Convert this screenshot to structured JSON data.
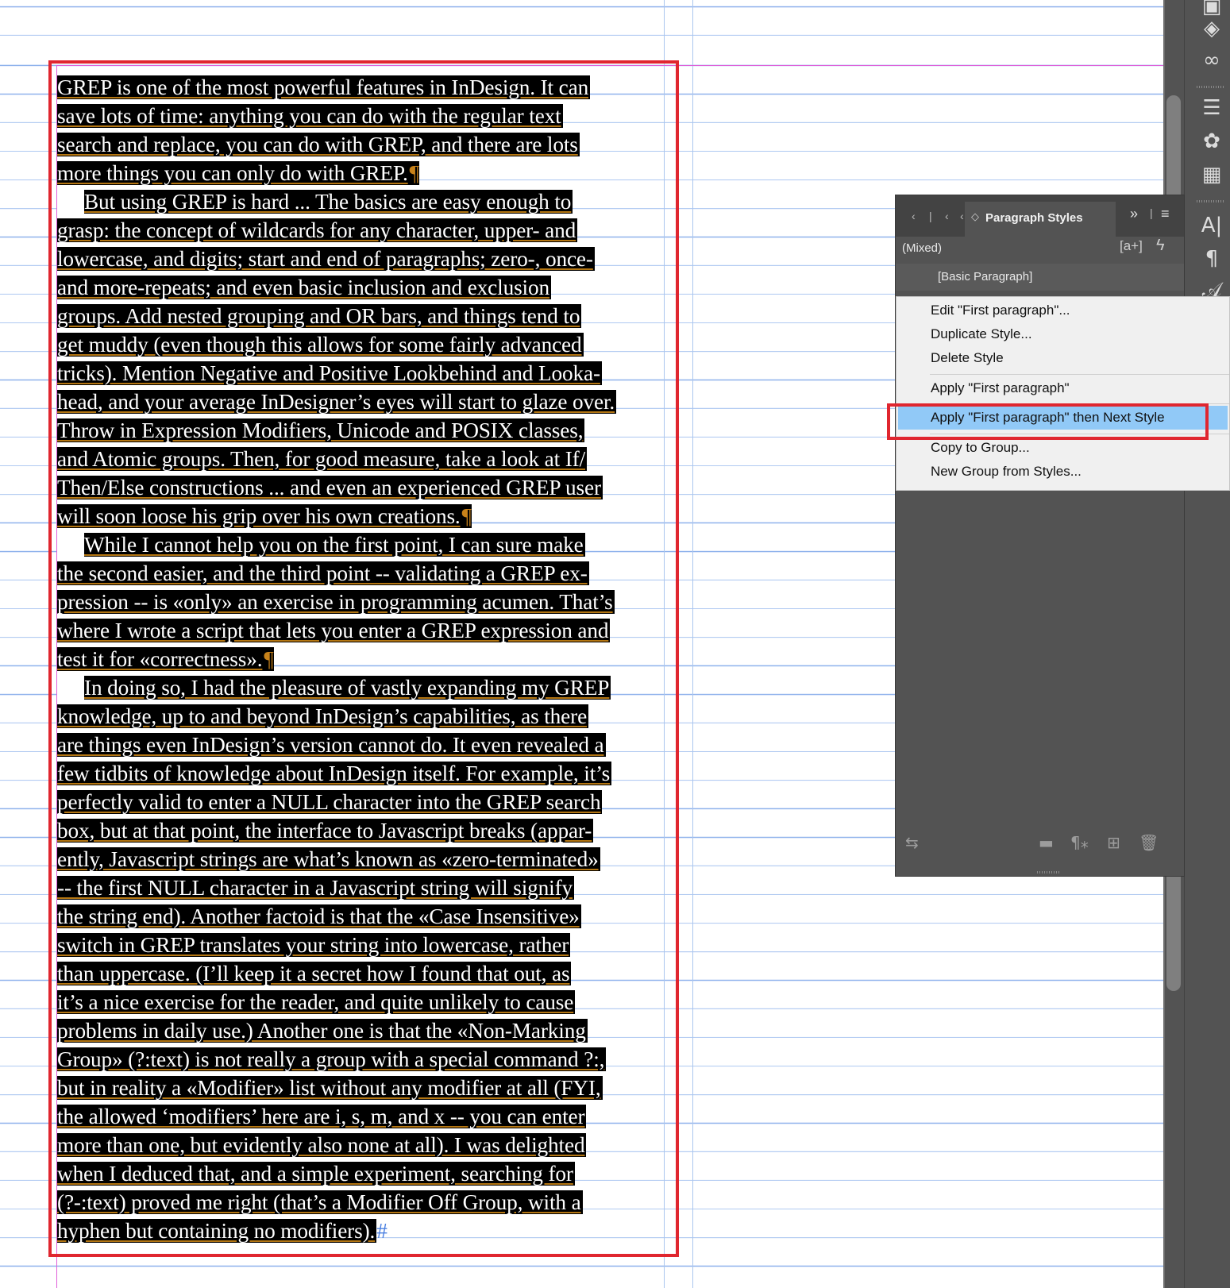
{
  "document": {
    "paragraphs": [
      {
        "lines": [
          "GREP is one of the most powerful features in InDesign. It can",
          "save lots of time: anything you can do with the regular text",
          "search and replace, you can do with GREP, and there are lots",
          "more things you can only do with GREP."
        ]
      },
      {
        "lines": [
          "But using GREP is hard ... The basics are easy enough to",
          "grasp: the concept of wildcards for any character, upper- and",
          "lowercase, and digits; start and end of paragraphs; zero-, once-",
          "and more-repeats; and even basic inclusion and exclusion",
          "groups. Add nested grouping and OR bars, and things tend to",
          "get muddy (even though this allows for some fairly advanced",
          "tricks). Mention Negative and Positive Lookbehind and Looka-",
          "head, and your average InDesigner’s eyes will start to glaze over.",
          "Throw in Expression Modifiers, Unicode and POSIX classes,",
          "and Atomic groups. Then, for good measure, take a look at If/",
          "Then/Else constructions ... and even an experienced GREP user",
          "will soon loose his grip over his own creations."
        ]
      },
      {
        "lines": [
          "While I cannot help you on the first point, I can sure make",
          "the second easier, and the third point -- validating a GREP ex-",
          "pression -- is «only» an exercise in programming acumen. That’s",
          "where I wrote a script that lets you enter a GREP expression and",
          "test it for «correctness»."
        ]
      },
      {
        "lines": [
          "In doing so, I had the pleasure of vastly expanding my GREP",
          "knowledge, up to and beyond InDesign’s capabilities, as there",
          "are things even InDesign’s version cannot do. It even revealed a",
          "few tidbits of knowledge about InDesign itself. For example, it’s",
          "perfectly valid to enter a NULL character into the GREP search",
          "box, but at that point, the interface to Javascript breaks (appar-",
          "ently, Javascript strings are what’s known as «zero-terminated»",
          "-- the first NULL character in a Javascript string will signify",
          "the string end). Another factoid is that the «Case Insensitive»",
          "switch in GREP translates your string into lowercase, rather",
          "than uppercase. (I’ll keep it a secret how I found that out, as",
          "it’s a nice exercise for the reader, and quite unlikely to cause",
          "problems in daily use.) Another one is that the «Non-Marking",
          "Group» (?:text) is not really a group with a special command ?:,",
          "but in reality a «Modifier» list without any modifier at all (FYI,",
          "the allowed ‘modifiers’ here are i, s, m, and x -- you can enter",
          "more than one, but evidently also none at all). I was delighted",
          "when I deduced that, and a simple experiment, searching for",
          "(?-:text) proved me right (that’s a Modifier Off Group, with a",
          "hyphen but containing no modifiers)."
        ]
      }
    ],
    "pilcrow": "¶",
    "end_of_story": "#"
  },
  "panel": {
    "title": "Paragraph Styles",
    "current_style": "(Mixed)",
    "new_style_icon_text": "[a+]",
    "styles": [
      "[Basic Paragraph]"
    ]
  },
  "context_menu": {
    "items": [
      "Edit \"First paragraph\"...",
      "Duplicate Style...",
      "Delete Style",
      "Apply \"First paragraph\"",
      "Apply \"First paragraph\" then Next Style",
      "Copy to Group...",
      "New Group from Styles..."
    ],
    "highlighted_index": 4
  },
  "icons": {
    "dock": [
      "pages-icon",
      "layers-icon",
      "links-icon",
      "stroke-icon",
      "swatches-icon",
      "color-grid-icon",
      "character-styles-icon",
      "paragraph-icon",
      "glyphs-icon"
    ],
    "panel_footer": [
      "import-icon",
      "new-group-folder-icon",
      "clear-overrides-icon",
      "new-style-icon",
      "delete-trash-icon"
    ]
  },
  "colors": {
    "selection_highlight": "#000000",
    "frame_outline": "#e0262f",
    "menu_highlight": "#91c9f7",
    "panel_bg": "#535353",
    "baseline_grid": "#8fb2ec"
  }
}
